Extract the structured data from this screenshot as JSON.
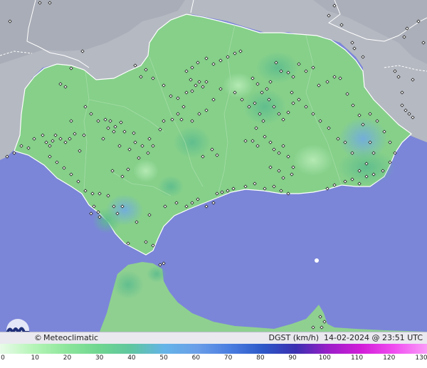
{
  "brand": {
    "name": "Meteoclimatic",
    "symbol": "©"
  },
  "caption": {
    "variable": "DGST",
    "unit": "(km/h)",
    "date": "14-02-2024",
    "at": "@",
    "time": "23:51",
    "tz": "UTC"
  },
  "scale": {
    "ticks": [
      "0",
      "10",
      "20",
      "30",
      "40",
      "50",
      "60",
      "70",
      "80",
      "90",
      "100",
      "110",
      "120",
      "130"
    ],
    "colors": [
      "#e8fbe8",
      "#b6f5b8",
      "#8ee69c",
      "#6fd690",
      "#5fc6a0",
      "#64b4e8",
      "#6a9ee8",
      "#4a7de0",
      "#2d58c8",
      "#3a2fb0",
      "#9a1ec8",
      "#d21ed8",
      "#f04ef0",
      "#fa9cf8"
    ]
  },
  "colors": {
    "sea": "#7b86d8",
    "land_outside": "#b8bcc4",
    "andalucia": "#86d08a",
    "morocco": "#8fd090",
    "border": "#ffffff",
    "station": "#ffffff"
  }
}
